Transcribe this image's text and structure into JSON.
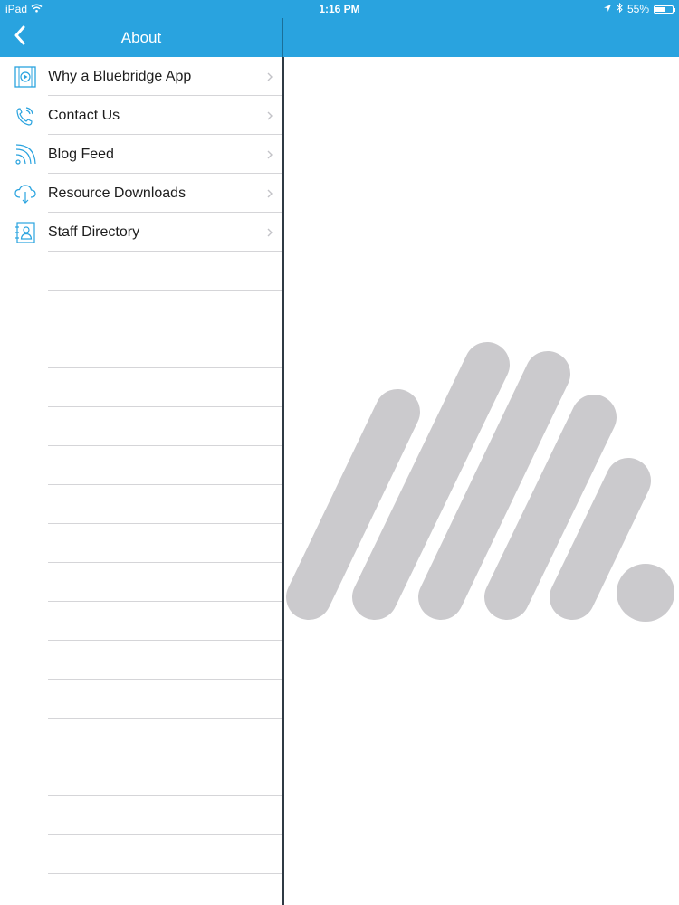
{
  "status_bar": {
    "device": "iPad",
    "time": "1:16 PM",
    "battery": "55%",
    "battery_level": 0.55
  },
  "nav": {
    "title": "About",
    "back_icon": "chevron-left-icon"
  },
  "menu": {
    "items": [
      {
        "label": "Why a Bluebridge App",
        "icon": "video-player-icon"
      },
      {
        "label": "Contact Us",
        "icon": "phone-icon"
      },
      {
        "label": "Blog Feed",
        "icon": "rss-icon"
      },
      {
        "label": "Resource Downloads",
        "icon": "cloud-download-icon"
      },
      {
        "label": "Staff Directory",
        "icon": "contact-book-icon"
      }
    ]
  },
  "colors": {
    "accent": "#29a3df",
    "logo_gray": "#cbcacd",
    "divider": "#2f3a44"
  }
}
